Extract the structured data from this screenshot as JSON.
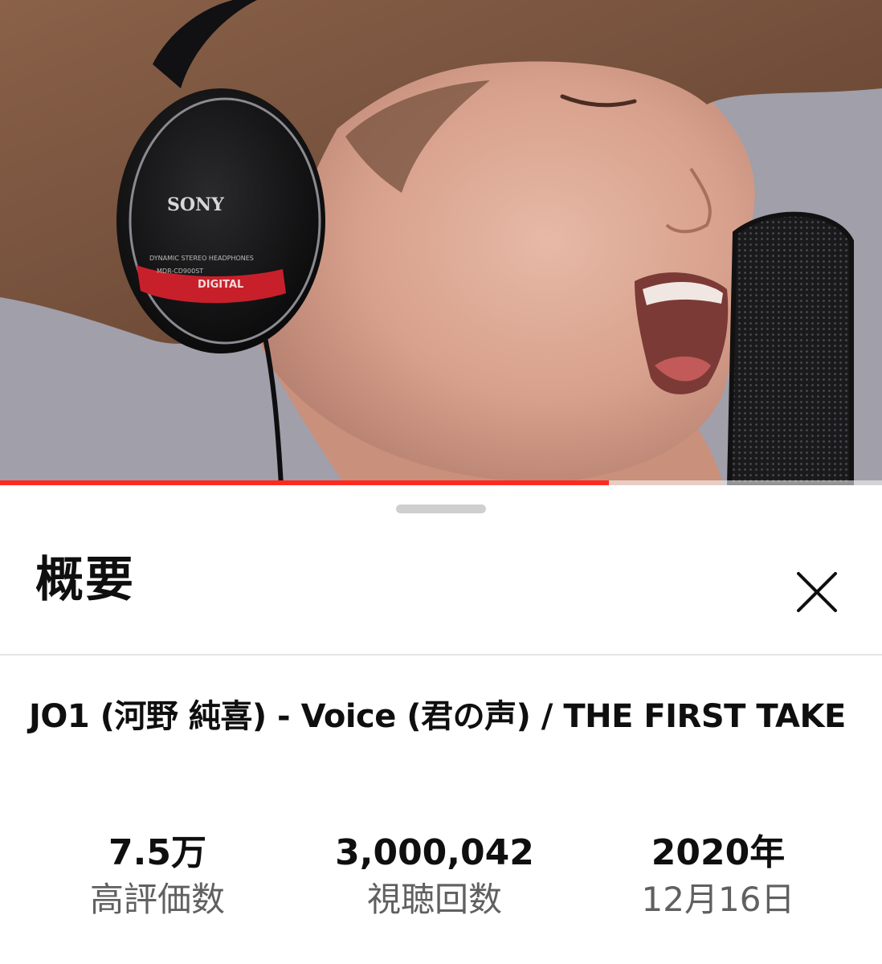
{
  "video": {
    "headphone_brand": "SONY",
    "headphone_model_text": "DYNAMIC STEREO HEADPHONES",
    "headphone_model_no": "MDR-CD900ST",
    "headphone_badge": "DIGITAL",
    "progress_fraction": 0.69,
    "progress_color": "#ff2a1f"
  },
  "sheet": {
    "title": "概要",
    "close_icon": "close-icon"
  },
  "details": {
    "video_title": "JO1 (河野 純喜) - Voice (君の声)  / THE FIRST TAKE"
  },
  "stats": {
    "likes": {
      "value": "7.5万",
      "label": "高評価数"
    },
    "views": {
      "value": "3,000,042",
      "label": "視聴回数"
    },
    "date": {
      "value": "2020年",
      "label": "12月16日"
    }
  }
}
